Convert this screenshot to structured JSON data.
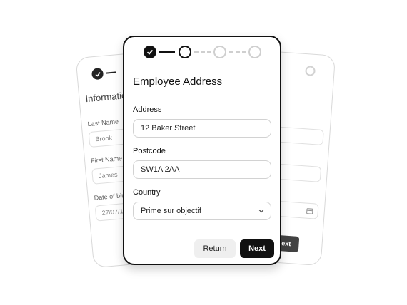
{
  "back_left": {
    "title": "Informatio",
    "fields": [
      {
        "label": "Last Name",
        "value": "Brook"
      },
      {
        "label": "First Name",
        "value": "James"
      },
      {
        "label": "Date of bir",
        "value": "27/07/19"
      }
    ]
  },
  "back_right": {
    "next_label": "Next"
  },
  "form": {
    "title": "Employee Address",
    "address": {
      "label": "Address",
      "value": "12 Baker Street"
    },
    "postcode": {
      "label": "Postcode",
      "value": "SW1A 2AA"
    },
    "country": {
      "label": "Country",
      "value": "Prime sur objectif"
    },
    "return_label": "Return",
    "next_label": "Next"
  },
  "stepper": {
    "total_steps": 4,
    "completed": 1,
    "current": 2
  },
  "colors": {
    "primary": "#111111",
    "border": "#d2d2d2",
    "muted": "#cfcfcf",
    "secondary_button": "#efefef"
  }
}
